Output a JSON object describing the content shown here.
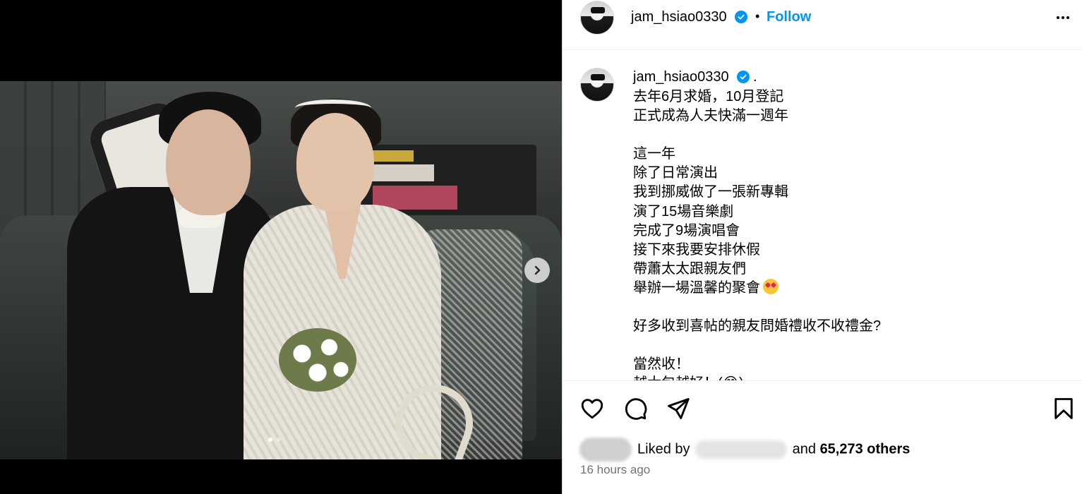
{
  "post": {
    "username": "jam_hsiao0330",
    "follow_label": "Follow",
    "separator": "•",
    "caption_suffix": ".",
    "caption_lines": [
      "去年6月求婚，10月登記",
      "正式成為人夫快滿一週年",
      "",
      "這一年",
      "除了日常演出",
      "我到挪威做了一張新專輯",
      "演了15場音樂劇",
      "完成了9場演唱會",
      "接下來我要安排休假",
      "帶蕭太太跟親友們",
      "舉辦一場溫馨的聚會",
      "",
      "好多收到喜帖的親友問婚禮收不收禮金?",
      "",
      "當然收！",
      "越大包越好！(😂)"
    ],
    "liked_by_label": "Liked by",
    "and_label": "and",
    "likes_count": "65,273 others",
    "timestamp": "16 hours ago"
  },
  "carousel": {
    "current_index": 1,
    "total": 2
  },
  "icons": {
    "next": "chevron-right-icon",
    "like": "heart-icon",
    "comment": "comment-icon",
    "share": "send-icon",
    "save": "bookmark-icon",
    "more": "more-horizontal-icon",
    "verified": "verified-badge-icon"
  },
  "colors": {
    "accent": "#0095f6",
    "muted": "#737373"
  }
}
